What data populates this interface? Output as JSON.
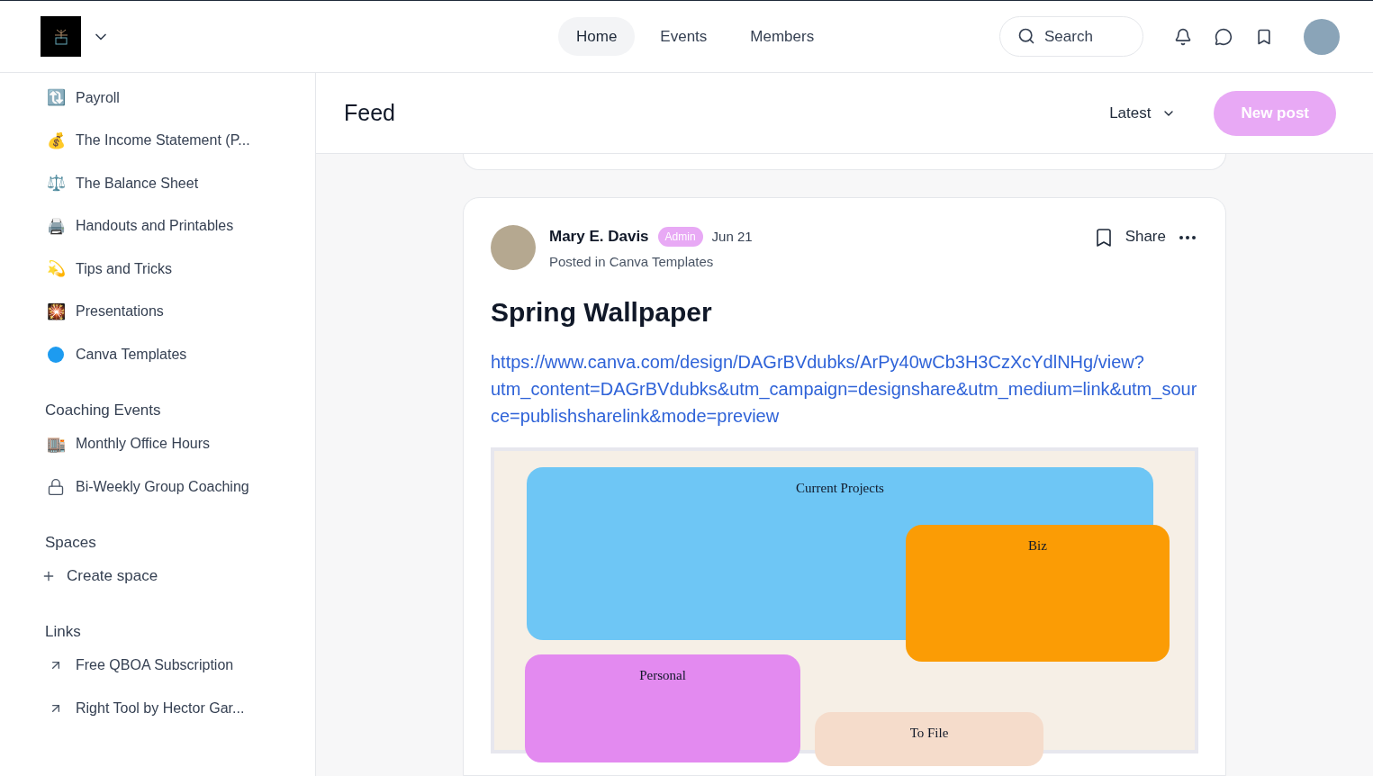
{
  "header": {
    "nav": [
      {
        "label": "Home",
        "selected": true
      },
      {
        "label": "Events",
        "selected": false
      },
      {
        "label": "Members",
        "selected": false
      }
    ],
    "search": {
      "placeholder": "Search"
    }
  },
  "sidebar": {
    "items": [
      {
        "label": "Payroll",
        "kind": "emoji",
        "emoji": "🔃"
      },
      {
        "label": "The Income Statement (P...",
        "kind": "emoji",
        "emoji": "💰"
      },
      {
        "label": "The Balance Sheet",
        "kind": "emoji",
        "emoji": "⚖️"
      },
      {
        "label": "Handouts and Printables",
        "kind": "emoji",
        "emoji": "🖨️"
      },
      {
        "label": "Tips and Tricks",
        "kind": "emoji",
        "emoji": "💫"
      },
      {
        "label": "Presentations",
        "kind": "emoji",
        "emoji": "🎇"
      },
      {
        "label": "Canva Templates",
        "kind": "dot",
        "color": "#1d9bf0"
      }
    ],
    "sections": [
      {
        "title": "Coaching Events",
        "items": [
          {
            "label": "Monthly Office Hours",
            "kind": "emoji",
            "emoji": "🏬"
          },
          {
            "label": "Bi-Weekly Group Coaching",
            "kind": "lock"
          }
        ]
      },
      {
        "title": "Spaces",
        "items": [
          {
            "label": "Create space",
            "kind": "add"
          }
        ]
      },
      {
        "title": "Links",
        "items": [
          {
            "label": "Free QBOA Subscription",
            "kind": "link"
          },
          {
            "label": "Right Tool by Hector Gar...",
            "kind": "link"
          }
        ]
      }
    ]
  },
  "feed": {
    "title": "Feed",
    "sort": "Latest",
    "new_post": "New post",
    "post": {
      "author": "Mary E. Davis",
      "badge": "Admin",
      "date": "Jun 21",
      "posted_in": "Posted in Canva Templates",
      "share": "Share",
      "title": "Spring Wallpaper",
      "link": "https://www.canva.com/design/DAGrBVdubks/ArPy40wCb3H3CzXcYdlNHg/view?utm_content=DAGrBVdubks&utm_campaign=designshare&utm_medium=link&utm_source=publishsharelink&mode=preview",
      "image": {
        "panels": [
          {
            "label": "Current Projects",
            "color": "#6ec6f5"
          },
          {
            "label": "Biz",
            "color": "#fb9c05"
          },
          {
            "label": "Personal",
            "color": "#e38af0"
          },
          {
            "label": "To File",
            "color": "#f5dccb"
          }
        ]
      }
    }
  }
}
